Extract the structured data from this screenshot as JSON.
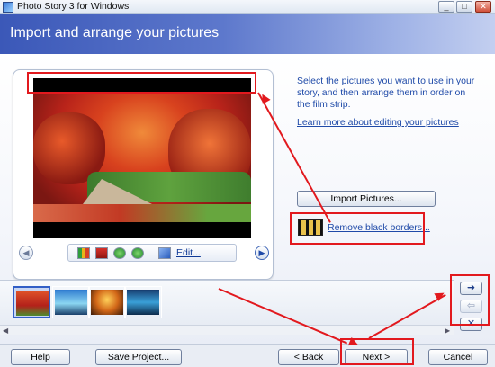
{
  "window": {
    "title": "Photo Story 3 for Windows",
    "controls": [
      "_",
      "□",
      "✕"
    ]
  },
  "header": {
    "title": "Import and arrange your pictures"
  },
  "preview": {
    "edit_label": "Edit...",
    "prev_icon": "left-arrow-circle-icon",
    "next_icon": "right-arrow-circle-icon",
    "tools": [
      "levels-icon",
      "red-eye-icon",
      "rotate-left-icon",
      "rotate-right-icon",
      "edit-icon"
    ]
  },
  "instructions": {
    "text": "Select the pictures you want to use in your story, and then arrange them in order on the film strip.",
    "learn_link": "Learn more about editing your pictures"
  },
  "import_button": "Import Pictures...",
  "remove_borders": {
    "label": "Remove black borders...",
    "icon": "filmstrip-remove-icon"
  },
  "filmstrip": {
    "thumbnails": [
      "autumn-road",
      "lake",
      "sunset",
      "sea"
    ],
    "selected_index": 0
  },
  "side_controls": {
    "move_right": "➜",
    "move_left": "⇦",
    "delete": "✕"
  },
  "footer": {
    "help": "Help",
    "save_project": "Save Project...",
    "back": "< Back",
    "next": "Next >",
    "cancel": "Cancel"
  },
  "colors": {
    "annotation": "#e2191e",
    "banner": "#3b58b8",
    "link": "#1f4aa8"
  }
}
